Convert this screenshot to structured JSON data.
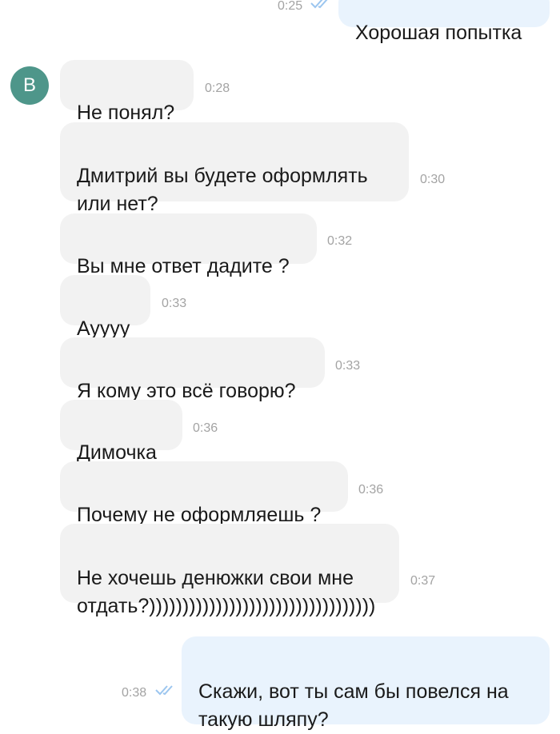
{
  "contact": {
    "initial": "В"
  },
  "messages": [
    {
      "direction": "out",
      "text": "Хорошая попытка",
      "time": "0:25",
      "status": "read"
    },
    {
      "direction": "in",
      "text": "Не понял?",
      "time": "0:28"
    },
    {
      "direction": "in",
      "text": "Дмитрий вы будете оформлять\nили нет?",
      "time": "0:30"
    },
    {
      "direction": "in",
      "text": "Вы мне ответ дадите ?",
      "time": "0:32"
    },
    {
      "direction": "in",
      "text": "Ауууу",
      "time": "0:33"
    },
    {
      "direction": "in",
      "text": "Я кому это всё говорю?",
      "time": "0:33"
    },
    {
      "direction": "in",
      "text": "Димочка",
      "time": "0:36"
    },
    {
      "direction": "in",
      "text": "Почему не оформляешь ?",
      "time": "0:36"
    },
    {
      "direction": "in",
      "text": "Не хочешь денюжки свои мне\nотдать?))))))))))))))))))))))))))))))))))",
      "time": "0:37"
    },
    {
      "direction": "out",
      "text": "Скажи, вот ты сам бы повелся на\nтакую шляпу?",
      "time": "0:38",
      "status": "read"
    }
  ],
  "colors": {
    "incoming_bubble": "#f2f2f2",
    "outgoing_bubble": "#e9f3fd",
    "avatar": "#4e968a",
    "read_checks": "#9cc6ef"
  },
  "icons": {
    "read_status": "double-check-icon"
  }
}
